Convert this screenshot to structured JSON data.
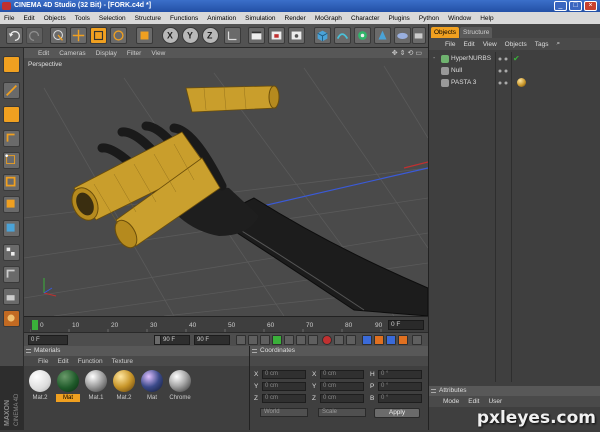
{
  "window": {
    "title": "CINEMA 4D Studio (32 Bit) - [FORK.c4d *]"
  },
  "menubar": [
    "File",
    "Edit",
    "Objects",
    "Tools",
    "Selection",
    "Structure",
    "Functions",
    "Animation",
    "Simulation",
    "Render",
    "MoGraph",
    "Character",
    "Plugins",
    "Python",
    "Window",
    "Help"
  ],
  "viewport": {
    "menu": [
      "Edit",
      "Cameras",
      "Display",
      "Filter",
      "View"
    ],
    "name": "Perspective"
  },
  "toolbar_icons": [
    "undo-icon",
    "redo-icon",
    "live-selection-icon",
    "move-icon",
    "scale-icon",
    "rotate-icon",
    "model-mode-icon",
    "x-axis-icon",
    "y-axis-icon",
    "z-axis-icon",
    "world-coordinates-icon",
    "render-view-icon",
    "render-picture-viewer-icon",
    "render-settings-icon",
    "cube-icon",
    "nurbs-icon",
    "array-icon",
    "deformer-icon",
    "scene-icon",
    "camera-icon",
    "light-icon"
  ],
  "axis_labels": {
    "x": "X",
    "y": "Y",
    "z": "Z"
  },
  "timeline": {
    "ticks": [
      "0",
      "10",
      "20",
      "30",
      "40",
      "50",
      "60",
      "70",
      "80",
      "90"
    ],
    "current_frame": "0 F"
  },
  "transport": {
    "start_field": "0 F",
    "end_field": "90 F",
    "max_field": "90 F"
  },
  "materials": {
    "title": "Materials",
    "menu": [
      "File",
      "Edit",
      "Function",
      "Texture"
    ],
    "items": [
      {
        "label": "Mat.2",
        "color": "#f4f4f4",
        "selected": false
      },
      {
        "label": "Mat",
        "color": "#1f5a2a",
        "selected": true
      },
      {
        "label": "Mat.1",
        "color": "#9a9a9a",
        "selected": false
      },
      {
        "label": "Mat.2",
        "color": "#c8962a",
        "selected": false
      },
      {
        "label": "Mat",
        "color": "#3b4a8a",
        "selected": false
      },
      {
        "label": "Chrome",
        "color": "#a8a8a8",
        "selected": false
      }
    ]
  },
  "coordinates": {
    "title": "Coordinates",
    "rows": [
      {
        "a": "X",
        "av": "0 cm",
        "b": "X",
        "bv": "0 cm",
        "c": "H",
        "cv": "0 °"
      },
      {
        "a": "Y",
        "av": "0 cm",
        "b": "Y",
        "bv": "0 cm",
        "c": "P",
        "cv": "0 °"
      },
      {
        "a": "Z",
        "av": "0 cm",
        "b": "Z",
        "bv": "0 cm",
        "c": "B",
        "cv": "0 °"
      }
    ],
    "mode": "World",
    "scale": "Scale",
    "apply": "Apply"
  },
  "object_manager": {
    "tabs": [
      "Objects",
      "Structure"
    ],
    "active_tab": "Objects",
    "menu": [
      "File",
      "Edit",
      "View",
      "Objects",
      "Tags"
    ],
    "objects": [
      {
        "name": "HyperNURBS",
        "color": "#6fb36f"
      },
      {
        "name": "Null",
        "color": "#aaaaaa"
      },
      {
        "name": "PASTA 3",
        "color": "#aaaaaa"
      }
    ]
  },
  "attributes": {
    "title": "Attributes",
    "menu": [
      "Mode",
      "Edit",
      "User"
    ]
  },
  "watermark": "pxleyes.com"
}
